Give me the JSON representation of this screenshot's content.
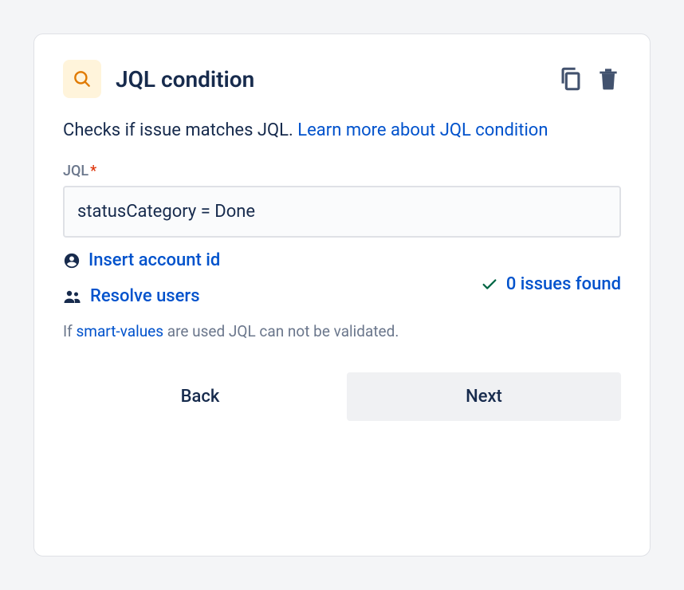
{
  "header": {
    "title": "JQL condition"
  },
  "description": {
    "text": "Checks if issue matches JQL. ",
    "link_text": "Learn more about JQL condition"
  },
  "field": {
    "label": "JQL",
    "required_marker": "*",
    "value": "statusCategory = Done"
  },
  "helpers": {
    "insert_account": "Insert account id",
    "resolve_users": "Resolve users",
    "issues_found": "0 issues found"
  },
  "note": {
    "prefix": "If ",
    "link": "smart-values",
    "suffix": " are used JQL can not be validated."
  },
  "footer": {
    "back": "Back",
    "next": "Next"
  }
}
